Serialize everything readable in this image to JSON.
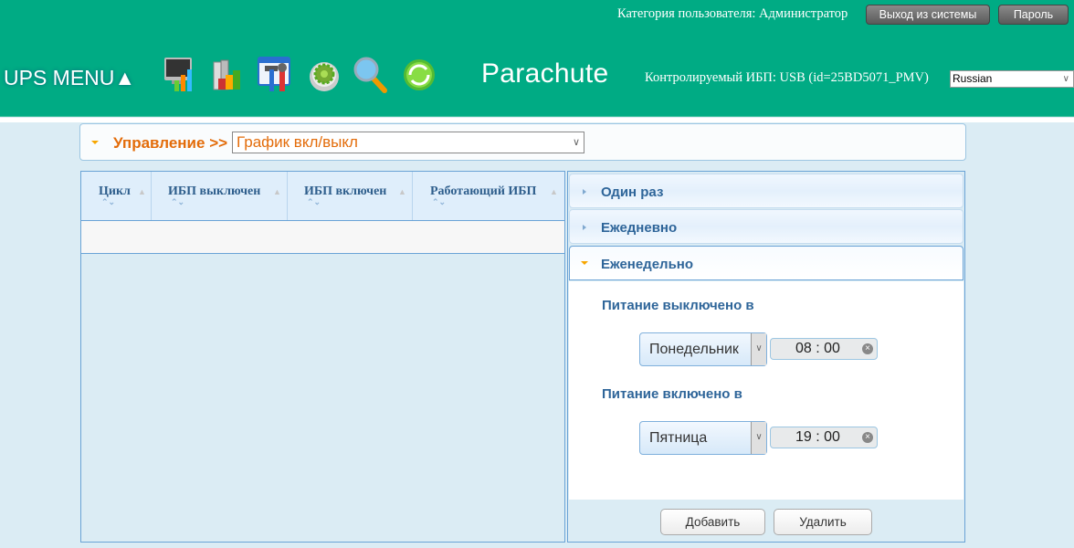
{
  "header": {
    "user_category": "Категория пользователя: Администратор",
    "logout_label": "Выход из системы",
    "password_label": "Пароль",
    "ups_menu": "UPS MENU▲",
    "icons": [
      "monitor-chart-icon",
      "books-chart-icon",
      "tools-icon",
      "gear-icon",
      "search-icon",
      "refresh-icon"
    ],
    "logo": "Parachute",
    "monitored_ups": "Контролируемый ИБП: USB (id=25BD5071_PMV)",
    "language": "Russian",
    "colors": {
      "brand": "#00ab84"
    }
  },
  "breadcrumb": {
    "section": "Управление >>",
    "page": "График вкл/выкл",
    "accent": "#e36c0a"
  },
  "table": {
    "columns": [
      "Цикл",
      "ИБП выключен",
      "ИБП включен",
      "Работающий ИБП"
    ],
    "rows": []
  },
  "schedule": {
    "sections": [
      {
        "label": "Один раз",
        "expanded": false
      },
      {
        "label": "Ежедневно",
        "expanded": false
      },
      {
        "label": "Еженедельно",
        "expanded": true
      }
    ],
    "power_off_label": "Питание выключено в",
    "power_off_day": "Понедельник",
    "power_off_time": "08 : 00",
    "power_on_label": "Питание включено в",
    "power_on_day": "Пятница",
    "power_on_time": "19 : 00",
    "add_label": "Добавить",
    "delete_label": "Удалить"
  }
}
